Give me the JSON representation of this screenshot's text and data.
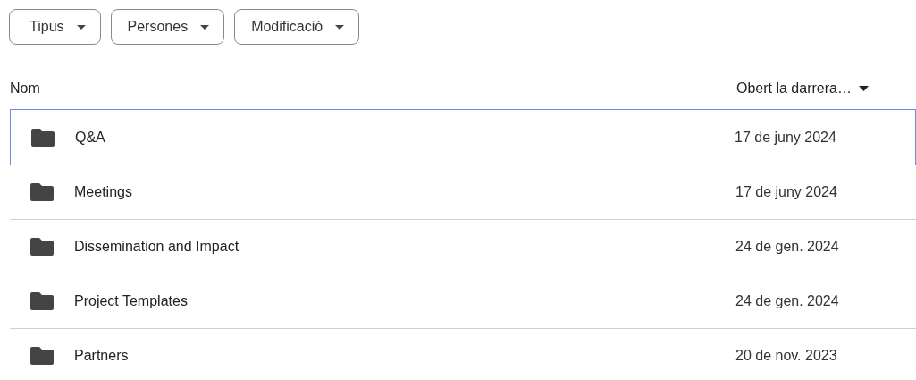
{
  "filters": [
    {
      "label": "Tipus"
    },
    {
      "label": "Persones"
    },
    {
      "label": "Modificació"
    }
  ],
  "table": {
    "columns": [
      {
        "label": "Nom",
        "sort_indicator": false
      },
      {
        "label": "Obert la darrera…",
        "sort_indicator": true
      }
    ],
    "rows": [
      {
        "name": "Q&A",
        "date": "17 de juny 2024",
        "selected": true
      },
      {
        "name": "Meetings",
        "date": "17 de juny 2024",
        "selected": false
      },
      {
        "name": "Dissemination and Impact",
        "date": "24 de gen. 2024",
        "selected": false
      },
      {
        "name": "Project Templates",
        "date": "24 de gen. 2024",
        "selected": false
      },
      {
        "name": "Partners",
        "date": "20 de nov. 2023",
        "selected": false
      }
    ]
  }
}
